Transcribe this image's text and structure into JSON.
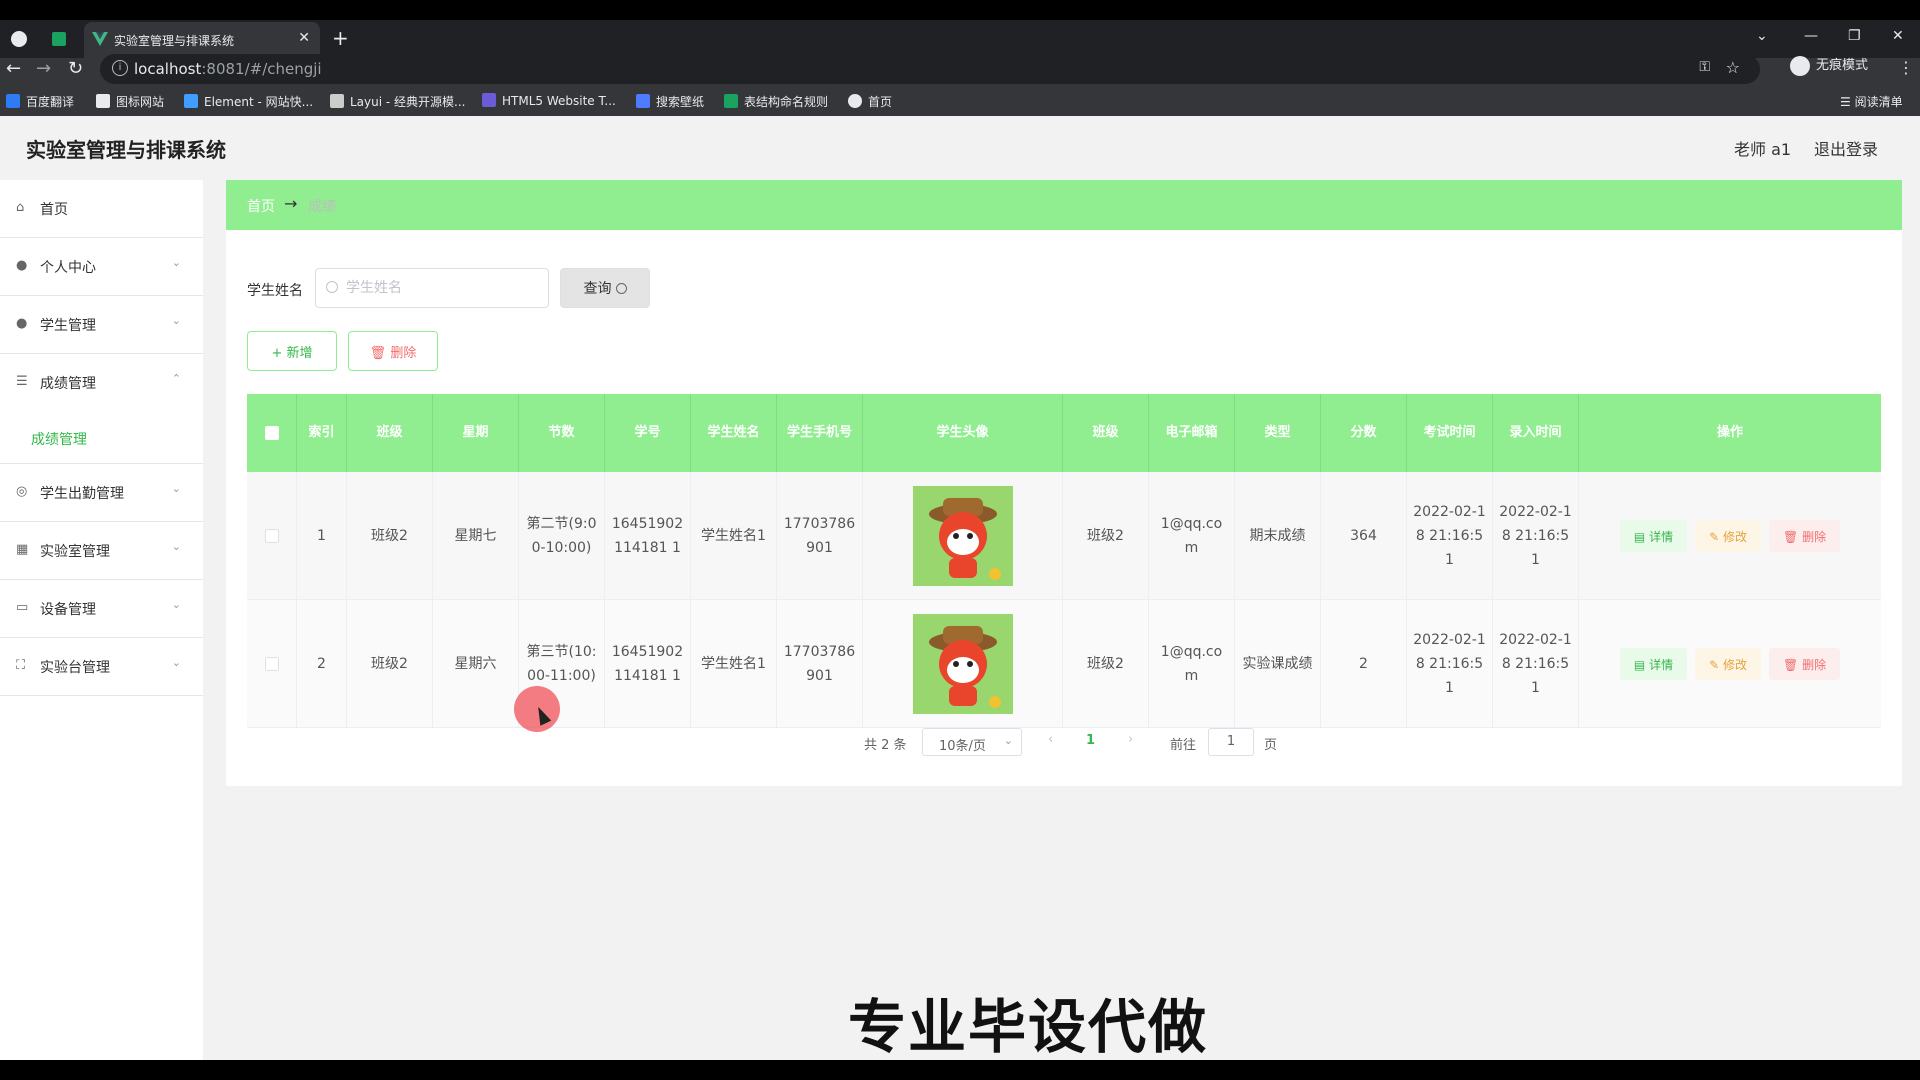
{
  "browser": {
    "tab_title": "实验室管理与排课系统",
    "url_host": "localhost",
    "url_rest": ":8081/#/chengji",
    "profile_label": "无痕模式",
    "bookmarks": [
      {
        "label": "百度翻译",
        "color": "#2d7cf6"
      },
      {
        "label": "图标网站",
        "color": "#e8eaed"
      },
      {
        "label": "Element - 网站快...",
        "color": "#409eff"
      },
      {
        "label": "Layui - 经典开源模...",
        "color": "#cccccc"
      },
      {
        "label": "HTML5 Website T...",
        "color": "#6b5bd6"
      },
      {
        "label": "搜索壁纸",
        "color": "#4f7cff"
      },
      {
        "label": "表结构命名规则",
        "color": "#1aa260"
      },
      {
        "label": "首页",
        "color": "#e8eaed"
      }
    ],
    "reading_list": "阅读清单"
  },
  "app": {
    "title": "实验室管理与排课系统",
    "user": "老师 a1",
    "logout": "退出登录"
  },
  "sidebar": {
    "items": [
      {
        "label": "首页",
        "icon": "home-icon",
        "expandable": false
      },
      {
        "label": "个人中心",
        "icon": "user-icon",
        "expandable": true,
        "open": false
      },
      {
        "label": "学生管理",
        "icon": "user-icon",
        "expandable": true,
        "open": false
      },
      {
        "label": "成绩管理",
        "icon": "sliders-icon",
        "expandable": true,
        "open": true
      },
      {
        "label": "学生出勤管理",
        "icon": "compass-icon",
        "expandable": true,
        "open": false
      },
      {
        "label": "实验室管理",
        "icon": "grid-icon",
        "expandable": true,
        "open": false
      },
      {
        "label": "设备管理",
        "icon": "monitor-icon",
        "expandable": true,
        "open": false
      },
      {
        "label": "实验台管理",
        "icon": "fullscreen-icon",
        "expandable": true,
        "open": false
      }
    ],
    "submenu_active": "成绩管理"
  },
  "breadcrumb": {
    "home": "首页",
    "arrow": "→",
    "current": "成绩"
  },
  "filter": {
    "label": "学生姓名",
    "placeholder": "学生姓名",
    "search_button": "查询"
  },
  "actions": {
    "add": "+ 新增",
    "delete": "删除"
  },
  "table": {
    "headers": [
      "索引",
      "班级",
      "星期",
      "节数",
      "学号",
      "学生姓名",
      "学生手机号",
      "学生头像",
      "班级",
      "电子邮箱",
      "类型",
      "分数",
      "考试时间",
      "录入时间",
      "操作"
    ],
    "rows": [
      {
        "index": "1",
        "class": "班级2",
        "weekday": "星期七",
        "period": "第二节(9:00-10:00)",
        "student_no": "16451902114181 1",
        "student_name": "学生姓名1",
        "phone": "17703786901",
        "class2": "班级2",
        "email": "1@qq.com",
        "type": "期末成绩",
        "score": "364",
        "exam_time": "2022-02-18 21:16:51",
        "entry_time": "2022-02-18 21:16:51"
      },
      {
        "index": "2",
        "class": "班级2",
        "weekday": "星期六",
        "period": "第三节(10:00-11:00)",
        "student_no": "16451902114181 1",
        "student_name": "学生姓名1",
        "phone": "17703786901",
        "class2": "班级2",
        "email": "1@qq.com",
        "type": "实验课成绩",
        "score": "2",
        "exam_time": "2022-02-18 21:16:51",
        "entry_time": "2022-02-18 21:16:51"
      }
    ],
    "row_actions": {
      "detail": "详情",
      "edit": "修改",
      "remove": "删除"
    }
  },
  "pagination": {
    "total": "共 2 条",
    "page_size": "10条/页",
    "current": "1",
    "goto_label": "前往",
    "goto_value": "1",
    "page_suffix": "页"
  },
  "watermark": "专业毕设代做",
  "colors": {
    "accent": "#90ee90",
    "active": "#33b84a",
    "danger": "#f56c6c",
    "warning": "#e6a23c"
  }
}
